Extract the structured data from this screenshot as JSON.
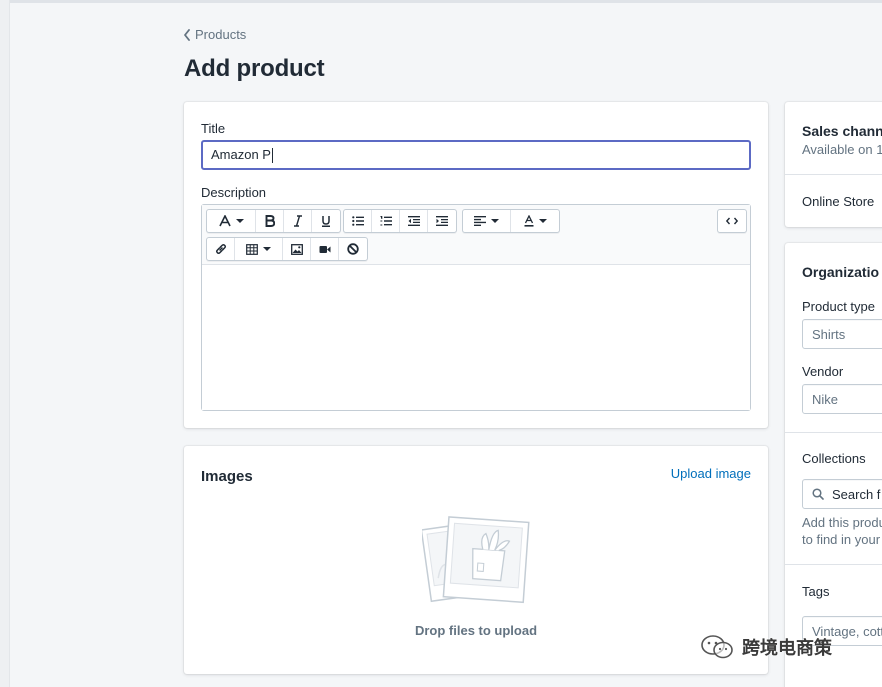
{
  "breadcrumb": {
    "label": "Products"
  },
  "page": {
    "title": "Add product"
  },
  "product": {
    "title_label": "Title",
    "title_value": "Amazon P",
    "description_label": "Description"
  },
  "images": {
    "title": "Images",
    "upload_label": "Upload image",
    "drop_text": "Drop files to upload"
  },
  "sales_channels": {
    "title": "Sales chann",
    "subtitle": "Available on 1",
    "channel": "Online Store"
  },
  "organization": {
    "title": "Organizatio",
    "product_type_label": "Product type",
    "product_type_placeholder": "Shirts",
    "vendor_label": "Vendor",
    "vendor_placeholder": "Nike",
    "collections_label": "Collections",
    "collections_placeholder": "Search f",
    "collections_help_1": "Add this produ",
    "collections_help_2": "to find in your",
    "tags_label": "Tags",
    "tags_placeholder": "Vintage, cott"
  },
  "watermark": {
    "text": "跨境电商策"
  },
  "colors": {
    "accent": "#5c6ac4",
    "link": "#006fbb",
    "background": "#f4f6f8",
    "text": "#212b36",
    "subdued": "#637381"
  }
}
